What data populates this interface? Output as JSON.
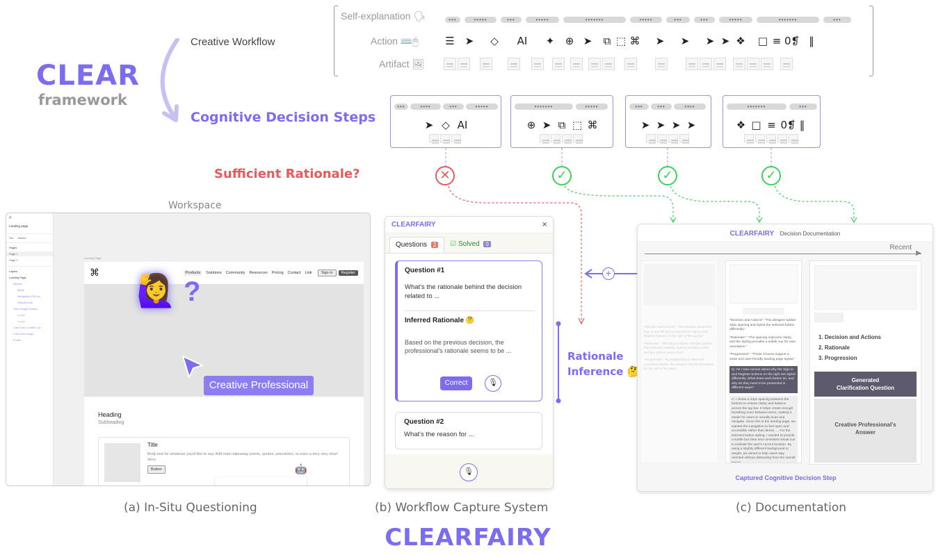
{
  "framework": {
    "logo": "CLEAR",
    "subtitle": "framework",
    "creative_workflow": "Creative Workflow",
    "cognitive_steps": "Cognitive Decision Steps",
    "sufficient_rationale": "Sufficient Rationale?"
  },
  "timeline": {
    "self_explanation": "Self-explanation 🗣",
    "action": "Action ⌨️🖱",
    "artifact": "Artifact 🖼",
    "pills": [
      "•••",
      "•••••",
      "•••",
      "•••••",
      "•••••••",
      "•••••",
      "•••",
      "•••",
      "•••••",
      "•••••••",
      "•••"
    ],
    "action_icons": [
      "☰",
      "➤",
      "◇",
      "AІ",
      "✦",
      "⊕",
      "➤",
      "⧉",
      "⬚",
      "⌘",
      "➤",
      "➤",
      "➤",
      "➤",
      "❖",
      "□",
      "≡",
      "0❡",
      "‖"
    ]
  },
  "steps": [
    {
      "pills": [
        "•••",
        "••••",
        "•••",
        "•••••"
      ],
      "icons": [
        "➤",
        "◇",
        "AІ"
      ],
      "status": "✕"
    },
    {
      "pills": [
        "•••••••",
        "•••••"
      ],
      "icons": [
        "⊕",
        "➤",
        "⧉",
        "⬚",
        "⌘"
      ],
      "status": "✓"
    },
    {
      "pills": [
        "•••",
        "•••",
        "••••"
      ],
      "icons": [
        "➤",
        "➤",
        "➤",
        "➤"
      ],
      "status": "✓"
    },
    {
      "pills": [
        "•••••••",
        "•••"
      ],
      "icons": [
        "❖",
        "□",
        "≡",
        "0❡",
        "‖"
      ],
      "status": "✓"
    }
  ],
  "workspace": {
    "title": "Workspace",
    "sidebar": {
      "page_name": "Landing page",
      "tab_file": "File",
      "tab_assets": "Assets",
      "pages_label": "Pages",
      "page1": "Page 1",
      "page2": "Page 2",
      "layers_label": "Layers",
      "layers": [
        "Landing Page",
        "Header",
        "Block",
        "Navigation Pill List",
        "Header Auth",
        "Hero Image Section",
        "Image",
        "Image",
        "Card Grid Content List",
        "Card Grid Image",
        "Footer"
      ]
    },
    "canvas_label": "Landing Page",
    "nav": [
      "Products",
      "Solutions",
      "Community",
      "Resources",
      "Pricing",
      "Contact",
      "Link"
    ],
    "sign_in": "Sign in",
    "register": "Register",
    "hand_emoji": "🙋‍♀️",
    "question_mark": "?",
    "creative_professional": "Creative Professional",
    "heading": "Heading",
    "subheading": "Subheading",
    "card_title": "Title",
    "card_body": "Body text for whatever you'd like to say. Add main takeaway points, quotes, anecdotes, or even a very very short story.",
    "card_button": "Button",
    "bot_emoji": "🤖"
  },
  "clearfairy": {
    "title": "CLEARFAIRY",
    "close": "×",
    "tab_questions": "Questions",
    "questions_count": "2",
    "tab_solved": "Solved",
    "solved_count": "0",
    "q1_label": "Question #1",
    "q1_text": "What's the rationale behind the decision related to ...",
    "inferred_label": "Inferred Rationale 🤔",
    "inferred_text": "Based on the previous decision, the professional's rationale seems to be ...",
    "correct_btn": "Correct",
    "mic": "🎙",
    "q2_label": "Question #2",
    "q2_text": "What's the reason for ..."
  },
  "rationale_inference": [
    "Rationale",
    "Inference 🤔"
  ],
  "plus": "+",
  "documentation": {
    "title": "CLEARFAIRY",
    "subtitle": "Decision Documentation",
    "recent": "Recent",
    "mid_text1": "\"Decision and Actions\": \"The designer added 32px spacing and styled the selected button differently.\"",
    "mid_text2": "\"Rationale\": \"The spacing improves clarity, and the styling provides a subtle cue for user orientation.\"",
    "mid_text3": "\"Progression\": \"These choices support a clean and user-friendly landing page layout.\"",
    "mid_q": "Q. Hi! I was curious about why the Sign In and Register buttons on the right are styled differently. What does each button do, and why do they need to be presented in different ways?",
    "mid_a": "A. I chose a 32px spacing between the buttons to ensure clarity and balance across the top bar. It helps create enough breathing room between items, making it easier for users to visually scan and navigate. Since this is the landing page, we wanted the navigation to feel open and accessible rather than dense. ... For the selected button styling, I wanted to provide a subtle but clear and consistent visual cue to indicate the user's current location. By using a slightly different background or weight, we aimed to help users stay oriented without distracting from the overall layout.",
    "left_text1": "\"Decision and Actions\": \"The designer placed the logo on the left and positioned the Sign In and Register buttons on the right of the top bar.\"",
    "left_text2": "\"Rationale\": \"This layout follows a familiar pattern that improves usability, making branding visible and key actions easy to find.\"",
    "left_text3": "\"Progression\": \"By establishing a clean and consistent header, the designer laid the foundation for the rest of the page.\"",
    "list": [
      "1. Decision and Actions",
      "2. Rationale",
      "3. Progression"
    ],
    "generated_q": "Generated\nClarification Question",
    "answer": "Creative Professional's\nAnswer",
    "captured": "Captured Cognitive Decision Step"
  },
  "captions": {
    "a": "(a) In-Situ Questioning",
    "b": "(b) Workflow Capture System",
    "c": "(c) Documentation"
  },
  "bottom_logo": "CLEARFAIRY"
}
